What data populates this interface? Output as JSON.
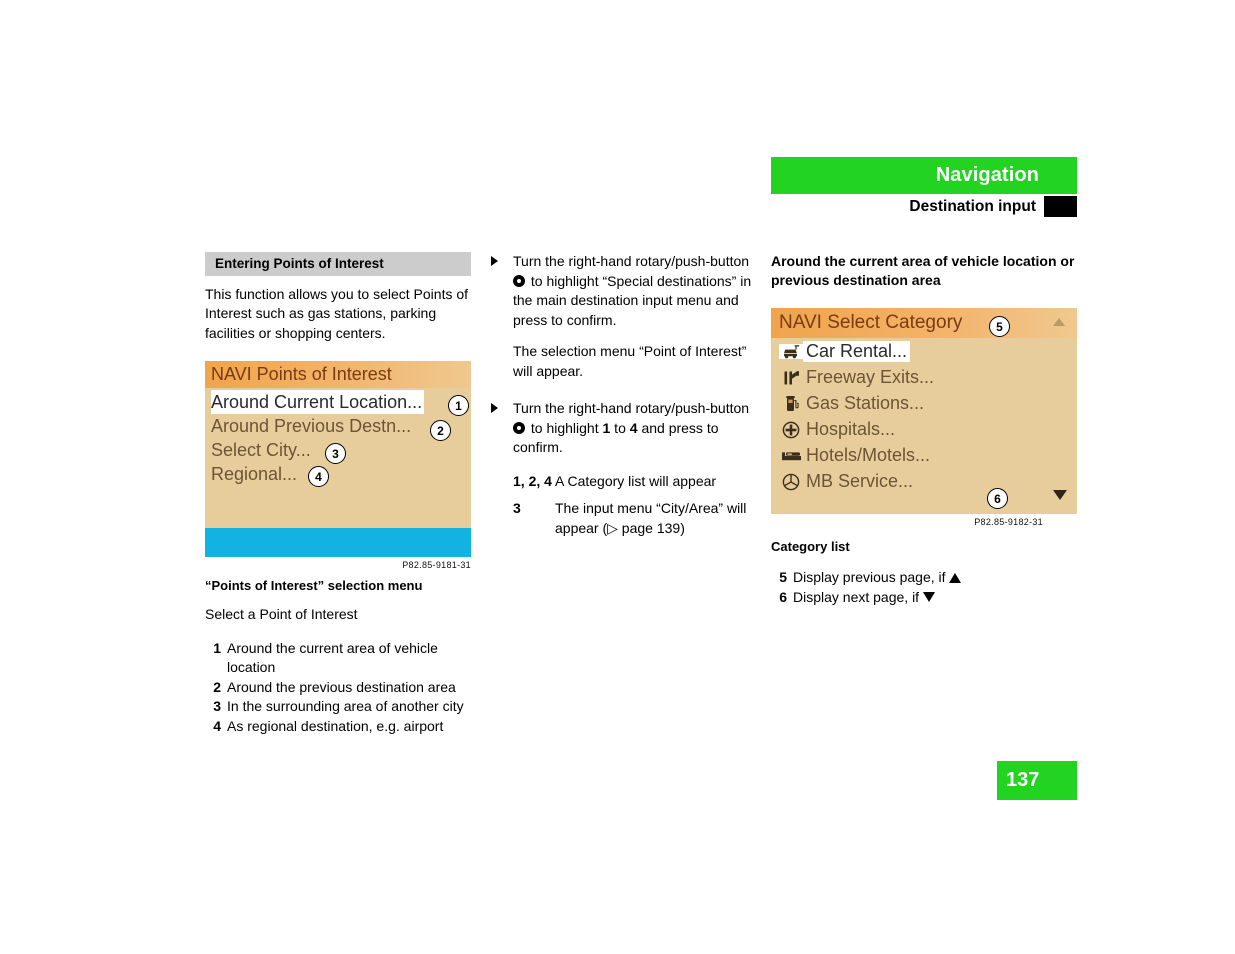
{
  "header": {
    "title": "Navigation",
    "subtitle": "Destination input",
    "accent_color": "#22d322",
    "marker_color": "#000000"
  },
  "page_number": "137",
  "left_column": {
    "section_heading": "Entering Points of Interest",
    "intro_paragraph": "This function allows you to select  Points of Interest such as gas stations, parking facilities or shopping centers.",
    "navi_screen": {
      "title": "NAVI Points of Interest",
      "items": [
        {
          "label": "Around Current Location...",
          "selected": true,
          "callout": "1"
        },
        {
          "label": "Around Previous Destn...",
          "selected": false,
          "callout": "2"
        },
        {
          "label": "Select City...",
          "selected": false,
          "callout": "3"
        },
        {
          "label": "Regional...",
          "selected": false,
          "callout": "4"
        }
      ],
      "background_color": "#e8cd9c",
      "title_bar_color": "#f0a44c",
      "status_band_color": "#12b3e3",
      "part_number": "P82.85-9181-31"
    },
    "figure_caption": "“Points of Interest” selection menu",
    "select_line": "Select a Point of Interest",
    "legend": [
      {
        "n": "1",
        "text": "Around the current area of vehicle location"
      },
      {
        "n": "2",
        "text": "Around the previous destination area"
      },
      {
        "n": "3",
        "text": "In the surrounding area of another city"
      },
      {
        "n": "4",
        "text": "As regional destination, e.g. airport"
      }
    ]
  },
  "middle_column": {
    "step1": {
      "line1": "Turn the right-hand rotary/push-button",
      "line2_after_knob": " to highlight “Special destinations” in the main destination input menu and press to confirm."
    },
    "step1_result": "The selection menu “Point of Interest” will appear.",
    "step2": {
      "line1": "Turn the right-hand rotary/push-button",
      "part_a": " to highlight ",
      "bold_a": "1",
      "part_b": " to ",
      "bold_b": "4",
      "part_c": " and press to confirm."
    },
    "definitions": [
      {
        "term": "1, 2, 4",
        "desc": "A Category list will appear"
      },
      {
        "term": "3",
        "desc": "The input menu “City/Area” will appear (▷ page 139)"
      }
    ]
  },
  "right_column": {
    "heading": "Around the current area of vehicle location or previous destination area",
    "navi_screen": {
      "title": "NAVI Select Category",
      "items": [
        {
          "label": "Car Rental...",
          "icon": "car-rental-icon",
          "selected": true
        },
        {
          "label": "Freeway Exits...",
          "icon": "freeway-exit-icon",
          "selected": false
        },
        {
          "label": "Gas Stations...",
          "icon": "gas-pump-icon",
          "selected": false
        },
        {
          "label": "Hospitals...",
          "icon": "hospital-cross-icon",
          "selected": false
        },
        {
          "label": "Hotels/Motels...",
          "icon": "hotel-bed-icon",
          "selected": false
        },
        {
          "label": "MB Service...",
          "icon": "mercedes-star-icon",
          "selected": false
        }
      ],
      "callout_top": "5",
      "callout_bottom": "6",
      "scroll_up_icon": "triangle-up-icon",
      "scroll_down_icon": "triangle-down-icon",
      "background_color": "#e8cd9c",
      "title_bar_color": "#f0a44c",
      "part_number": "P82.85-9182-31"
    },
    "figure_caption": "Category list",
    "legend": [
      {
        "n": "5",
        "text_before": "Display previous page, if ",
        "arrow": "triangle-up-icon"
      },
      {
        "n": "6",
        "text_before": "Display next page, if ",
        "arrow": "triangle-down-icon"
      }
    ]
  }
}
